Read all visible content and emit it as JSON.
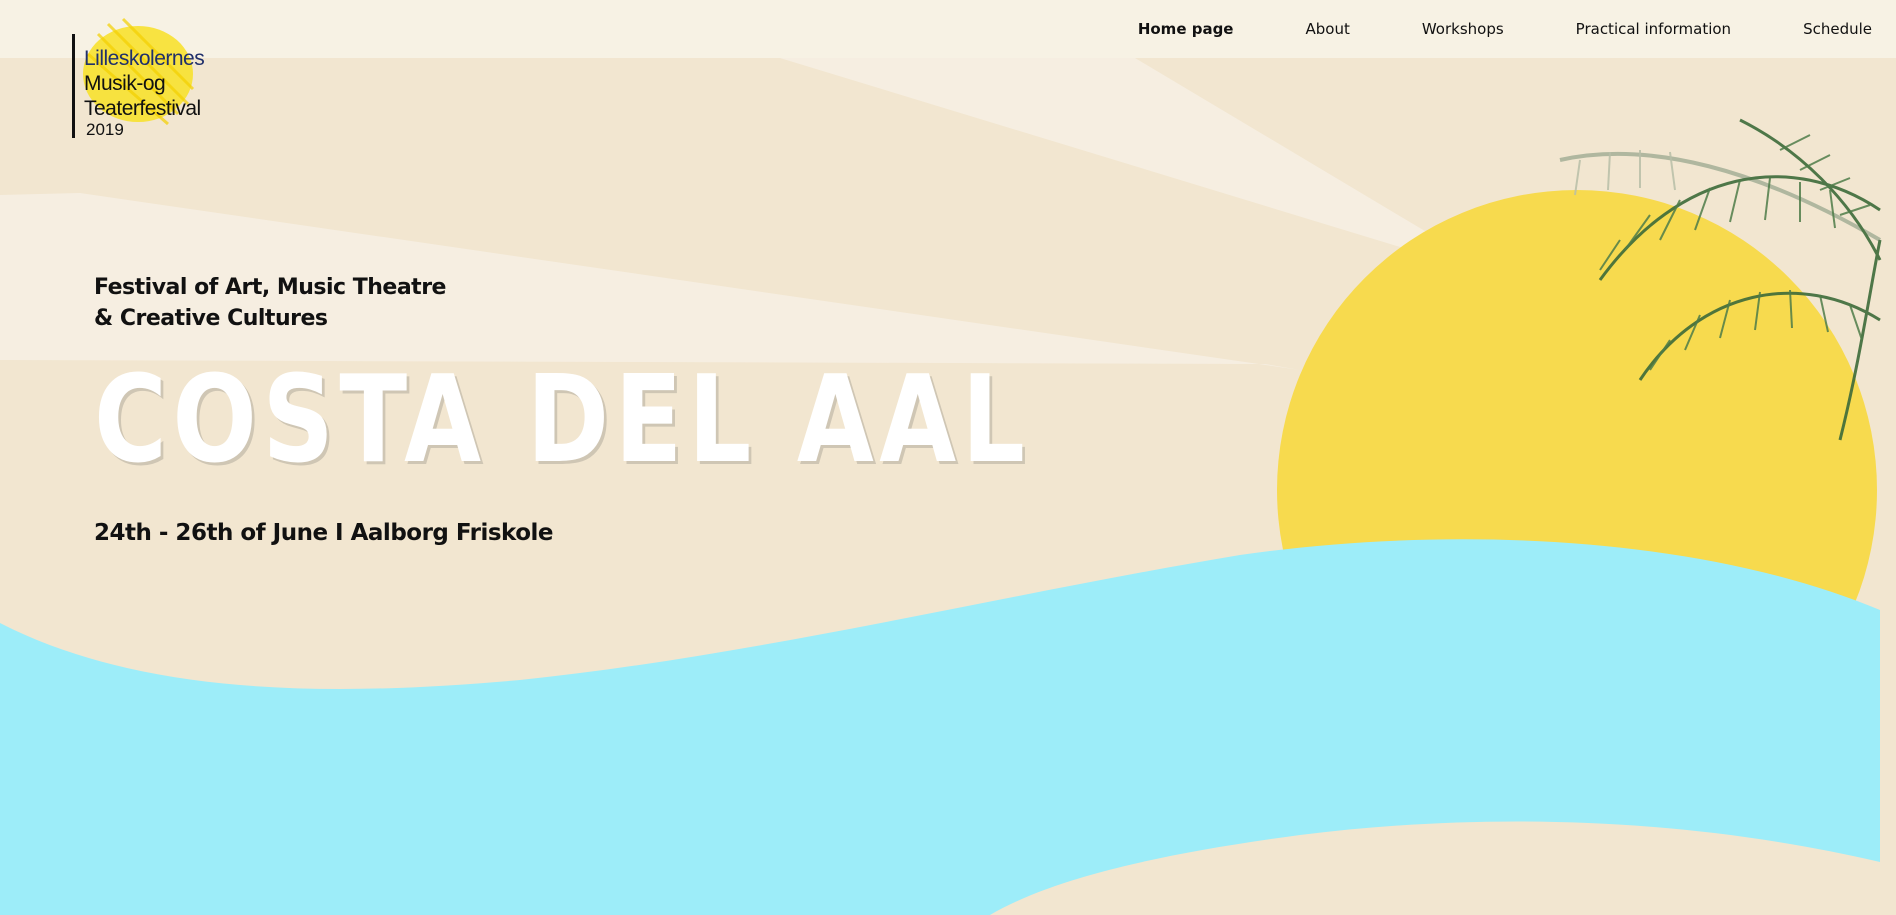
{
  "logo": {
    "lines": [
      "Lilleskolernes",
      "Musik-og",
      "Teaterfestival"
    ],
    "year": "2019"
  },
  "nav": {
    "items": [
      {
        "label": "Home page",
        "active": true
      },
      {
        "label": "About",
        "active": false
      },
      {
        "label": "Workshops",
        "active": false
      },
      {
        "label": "Practical information",
        "active": false
      },
      {
        "label": "Schedule",
        "active": false
      }
    ]
  },
  "hero": {
    "subtitle_line1": "Festival of Art, Music Theatre",
    "subtitle_line2": "& Creative Cultures",
    "title": "COSTA DEL AAL",
    "dates": "24th - 26th of June I Aalborg Friskole"
  },
  "colors": {
    "sand": "#F2E6D0",
    "ray": "#F6EEE1",
    "sun": "#F7DA4E",
    "sea": "#9DEDF9",
    "topbar": "#F7F2E4"
  }
}
